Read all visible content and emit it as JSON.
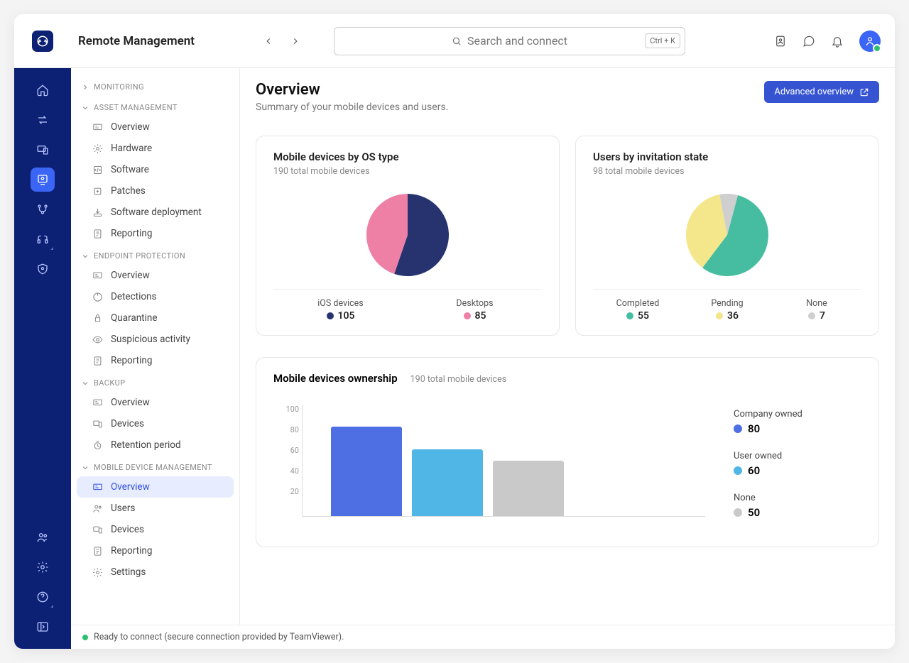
{
  "header": {
    "title": "Remote Management",
    "search_placeholder": "Search and connect",
    "search_kbd": "Ctrl + K"
  },
  "page": {
    "title": "Overview",
    "subtitle": "Summary of your mobile devices and users.",
    "adv_btn": "Advanced overview"
  },
  "sections": {
    "monitoring": "MONITORING",
    "asset": "ASSET MANAGEMENT",
    "endpoint": "ENDPOINT PROTECTION",
    "backup": "BACKUP",
    "mdm": "MOBILE DEVICE MANAGEMENT"
  },
  "nav": {
    "asset": [
      "Overview",
      "Hardware",
      "Software",
      "Patches",
      "Software deployment",
      "Reporting"
    ],
    "endpoint": [
      "Overview",
      "Detections",
      "Quarantine",
      "Suspicious activity",
      "Reporting"
    ],
    "backup": [
      "Overview",
      "Devices",
      "Retention period"
    ],
    "mdm": [
      "Overview",
      "Users",
      "Devices",
      "Reporting",
      "Settings"
    ]
  },
  "cards": {
    "os": {
      "title": "Mobile devices by OS type",
      "sub": "190 total mobile devices",
      "l1": "iOS devices",
      "v1": "105",
      "l2": "Desktops",
      "v2": "85"
    },
    "inv": {
      "title": "Users by invitation state",
      "sub": "98 total mobile devices",
      "l1": "Completed",
      "v1": "55",
      "l2": "Pending",
      "v2": "36",
      "l3": "None",
      "v3": "7"
    },
    "own": {
      "title": "Mobile devices ownership",
      "sub": "190 total mobile devices",
      "l1": "Company owned",
      "v1": "80",
      "l2": "User owned",
      "v2": "60",
      "l3": "None",
      "v3": "50"
    }
  },
  "status": "Ready to connect (secure connection provided by TeamViewer).",
  "chart_data": [
    {
      "type": "pie",
      "title": "Mobile devices by OS type",
      "series": [
        {
          "name": "iOS devices",
          "value": 105,
          "color": "#27336f"
        },
        {
          "name": "Desktops",
          "value": 85,
          "color": "#ee7fa5"
        }
      ]
    },
    {
      "type": "pie",
      "title": "Users by invitation state",
      "series": [
        {
          "name": "Completed",
          "value": 55,
          "color": "#46bda0"
        },
        {
          "name": "Pending",
          "value": 36,
          "color": "#f4e68b"
        },
        {
          "name": "None",
          "value": 7,
          "color": "#cfcfcf"
        }
      ]
    },
    {
      "type": "bar",
      "title": "Mobile devices ownership",
      "ylim": [
        0,
        100
      ],
      "yticks": [
        20,
        40,
        60,
        80,
        100
      ],
      "categories": [
        "Company owned",
        "User owned",
        "None"
      ],
      "values": [
        80,
        60,
        50
      ],
      "colors": [
        "#4d6fe3",
        "#4fb6e6",
        "#c9c9c9"
      ]
    }
  ],
  "colors": {
    "navy": "#27336f",
    "pink": "#ee7fa5",
    "teal": "#46bda0",
    "yellow": "#f4e68b",
    "grey": "#cfcfcf",
    "blue": "#4d6fe3",
    "sky": "#4fb6e6",
    "grey2": "#c9c9c9"
  }
}
